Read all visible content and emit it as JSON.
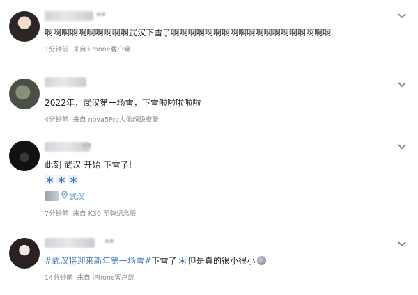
{
  "posts": [
    {
      "content": "啊啊啊啊啊啊啊啊啊啊武汉下雪了啊啊啊啊啊啊啊啊啊啊啊啊啊啊啊啊啊啊啊",
      "time": "1分钟前",
      "source": "来自 iPhone客户端"
    },
    {
      "content": "2022年，武汉第一场雪，下雪啦啦啦啦啦",
      "time": "4分钟前",
      "source": "来自 nova5Pro人像超级夜景"
    },
    {
      "content": "此刻 武汉 开始 下雪了!",
      "location": "武汉",
      "time": "7分钟前",
      "source": "来自 K30 至尊纪念版"
    },
    {
      "hashtag": "#武汉将迎来新年第一场雪#",
      "content_mid": "下雪了",
      "content_end": "但是真的很小很小",
      "time": "14分钟前",
      "source": "来自 iPhone客户端"
    }
  ],
  "icons": {
    "snowflake": "snowflake-icon",
    "location": "location-pin-icon",
    "expand": "chevron-down-icon"
  },
  "colors": {
    "link": "#5a8fd0",
    "meta": "#8a8a8a",
    "text": "#222222"
  }
}
